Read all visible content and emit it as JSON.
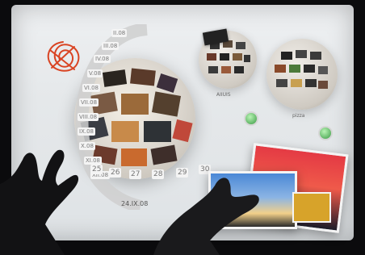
{
  "timeline": {
    "day_numbers": [
      "25",
      "26",
      "27",
      "28",
      "29",
      "30"
    ],
    "month_labels": [
      "II.08",
      "III.08",
      "IV.08",
      "V.08",
      "VI.08",
      "VII.08",
      "VIII.08",
      "IX.08",
      "X.08",
      "XI.08",
      "XII.08"
    ],
    "selected_date": "24.IX.08"
  },
  "spheres": {
    "small_left_label": "AIIUIS",
    "small_right_label": "pizza"
  }
}
